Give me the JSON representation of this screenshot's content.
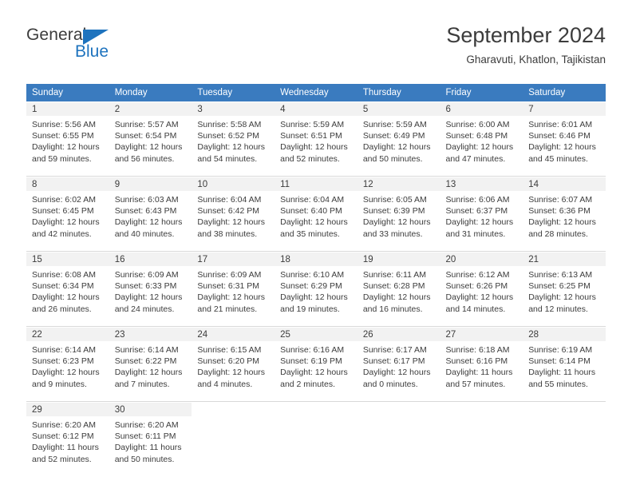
{
  "brand": {
    "name_top": "General",
    "name_bottom": "Blue",
    "accent_color": "#1e73be",
    "triangle_icon": "brand-triangle-icon"
  },
  "header": {
    "title": "September 2024",
    "subtitle": "Gharavuti, Khatlon, Tajikistan"
  },
  "calendar": {
    "header_background": "#3a7bbf",
    "daynum_background": "#f2f2f2",
    "weekdays": [
      "Sunday",
      "Monday",
      "Tuesday",
      "Wednesday",
      "Thursday",
      "Friday",
      "Saturday"
    ],
    "weeks": [
      [
        {
          "day": "1",
          "sunrise": "Sunrise: 5:56 AM",
          "sunset": "Sunset: 6:55 PM",
          "daylight1": "Daylight: 12 hours",
          "daylight2": "and 59 minutes."
        },
        {
          "day": "2",
          "sunrise": "Sunrise: 5:57 AM",
          "sunset": "Sunset: 6:54 PM",
          "daylight1": "Daylight: 12 hours",
          "daylight2": "and 56 minutes."
        },
        {
          "day": "3",
          "sunrise": "Sunrise: 5:58 AM",
          "sunset": "Sunset: 6:52 PM",
          "daylight1": "Daylight: 12 hours",
          "daylight2": "and 54 minutes."
        },
        {
          "day": "4",
          "sunrise": "Sunrise: 5:59 AM",
          "sunset": "Sunset: 6:51 PM",
          "daylight1": "Daylight: 12 hours",
          "daylight2": "and 52 minutes."
        },
        {
          "day": "5",
          "sunrise": "Sunrise: 5:59 AM",
          "sunset": "Sunset: 6:49 PM",
          "daylight1": "Daylight: 12 hours",
          "daylight2": "and 50 minutes."
        },
        {
          "day": "6",
          "sunrise": "Sunrise: 6:00 AM",
          "sunset": "Sunset: 6:48 PM",
          "daylight1": "Daylight: 12 hours",
          "daylight2": "and 47 minutes."
        },
        {
          "day": "7",
          "sunrise": "Sunrise: 6:01 AM",
          "sunset": "Sunset: 6:46 PM",
          "daylight1": "Daylight: 12 hours",
          "daylight2": "and 45 minutes."
        }
      ],
      [
        {
          "day": "8",
          "sunrise": "Sunrise: 6:02 AM",
          "sunset": "Sunset: 6:45 PM",
          "daylight1": "Daylight: 12 hours",
          "daylight2": "and 42 minutes."
        },
        {
          "day": "9",
          "sunrise": "Sunrise: 6:03 AM",
          "sunset": "Sunset: 6:43 PM",
          "daylight1": "Daylight: 12 hours",
          "daylight2": "and 40 minutes."
        },
        {
          "day": "10",
          "sunrise": "Sunrise: 6:04 AM",
          "sunset": "Sunset: 6:42 PM",
          "daylight1": "Daylight: 12 hours",
          "daylight2": "and 38 minutes."
        },
        {
          "day": "11",
          "sunrise": "Sunrise: 6:04 AM",
          "sunset": "Sunset: 6:40 PM",
          "daylight1": "Daylight: 12 hours",
          "daylight2": "and 35 minutes."
        },
        {
          "day": "12",
          "sunrise": "Sunrise: 6:05 AM",
          "sunset": "Sunset: 6:39 PM",
          "daylight1": "Daylight: 12 hours",
          "daylight2": "and 33 minutes."
        },
        {
          "day": "13",
          "sunrise": "Sunrise: 6:06 AM",
          "sunset": "Sunset: 6:37 PM",
          "daylight1": "Daylight: 12 hours",
          "daylight2": "and 31 minutes."
        },
        {
          "day": "14",
          "sunrise": "Sunrise: 6:07 AM",
          "sunset": "Sunset: 6:36 PM",
          "daylight1": "Daylight: 12 hours",
          "daylight2": "and 28 minutes."
        }
      ],
      [
        {
          "day": "15",
          "sunrise": "Sunrise: 6:08 AM",
          "sunset": "Sunset: 6:34 PM",
          "daylight1": "Daylight: 12 hours",
          "daylight2": "and 26 minutes."
        },
        {
          "day": "16",
          "sunrise": "Sunrise: 6:09 AM",
          "sunset": "Sunset: 6:33 PM",
          "daylight1": "Daylight: 12 hours",
          "daylight2": "and 24 minutes."
        },
        {
          "day": "17",
          "sunrise": "Sunrise: 6:09 AM",
          "sunset": "Sunset: 6:31 PM",
          "daylight1": "Daylight: 12 hours",
          "daylight2": "and 21 minutes."
        },
        {
          "day": "18",
          "sunrise": "Sunrise: 6:10 AM",
          "sunset": "Sunset: 6:29 PM",
          "daylight1": "Daylight: 12 hours",
          "daylight2": "and 19 minutes."
        },
        {
          "day": "19",
          "sunrise": "Sunrise: 6:11 AM",
          "sunset": "Sunset: 6:28 PM",
          "daylight1": "Daylight: 12 hours",
          "daylight2": "and 16 minutes."
        },
        {
          "day": "20",
          "sunrise": "Sunrise: 6:12 AM",
          "sunset": "Sunset: 6:26 PM",
          "daylight1": "Daylight: 12 hours",
          "daylight2": "and 14 minutes."
        },
        {
          "day": "21",
          "sunrise": "Sunrise: 6:13 AM",
          "sunset": "Sunset: 6:25 PM",
          "daylight1": "Daylight: 12 hours",
          "daylight2": "and 12 minutes."
        }
      ],
      [
        {
          "day": "22",
          "sunrise": "Sunrise: 6:14 AM",
          "sunset": "Sunset: 6:23 PM",
          "daylight1": "Daylight: 12 hours",
          "daylight2": "and 9 minutes."
        },
        {
          "day": "23",
          "sunrise": "Sunrise: 6:14 AM",
          "sunset": "Sunset: 6:22 PM",
          "daylight1": "Daylight: 12 hours",
          "daylight2": "and 7 minutes."
        },
        {
          "day": "24",
          "sunrise": "Sunrise: 6:15 AM",
          "sunset": "Sunset: 6:20 PM",
          "daylight1": "Daylight: 12 hours",
          "daylight2": "and 4 minutes."
        },
        {
          "day": "25",
          "sunrise": "Sunrise: 6:16 AM",
          "sunset": "Sunset: 6:19 PM",
          "daylight1": "Daylight: 12 hours",
          "daylight2": "and 2 minutes."
        },
        {
          "day": "26",
          "sunrise": "Sunrise: 6:17 AM",
          "sunset": "Sunset: 6:17 PM",
          "daylight1": "Daylight: 12 hours",
          "daylight2": "and 0 minutes."
        },
        {
          "day": "27",
          "sunrise": "Sunrise: 6:18 AM",
          "sunset": "Sunset: 6:16 PM",
          "daylight1": "Daylight: 11 hours",
          "daylight2": "and 57 minutes."
        },
        {
          "day": "28",
          "sunrise": "Sunrise: 6:19 AM",
          "sunset": "Sunset: 6:14 PM",
          "daylight1": "Daylight: 11 hours",
          "daylight2": "and 55 minutes."
        }
      ],
      [
        {
          "day": "29",
          "sunrise": "Sunrise: 6:20 AM",
          "sunset": "Sunset: 6:12 PM",
          "daylight1": "Daylight: 11 hours",
          "daylight2": "and 52 minutes."
        },
        {
          "day": "30",
          "sunrise": "Sunrise: 6:20 AM",
          "sunset": "Sunset: 6:11 PM",
          "daylight1": "Daylight: 11 hours",
          "daylight2": "and 50 minutes."
        },
        {
          "day": "",
          "sunrise": "",
          "sunset": "",
          "daylight1": "",
          "daylight2": ""
        },
        {
          "day": "",
          "sunrise": "",
          "sunset": "",
          "daylight1": "",
          "daylight2": ""
        },
        {
          "day": "",
          "sunrise": "",
          "sunset": "",
          "daylight1": "",
          "daylight2": ""
        },
        {
          "day": "",
          "sunrise": "",
          "sunset": "",
          "daylight1": "",
          "daylight2": ""
        },
        {
          "day": "",
          "sunrise": "",
          "sunset": "",
          "daylight1": "",
          "daylight2": ""
        }
      ]
    ]
  }
}
